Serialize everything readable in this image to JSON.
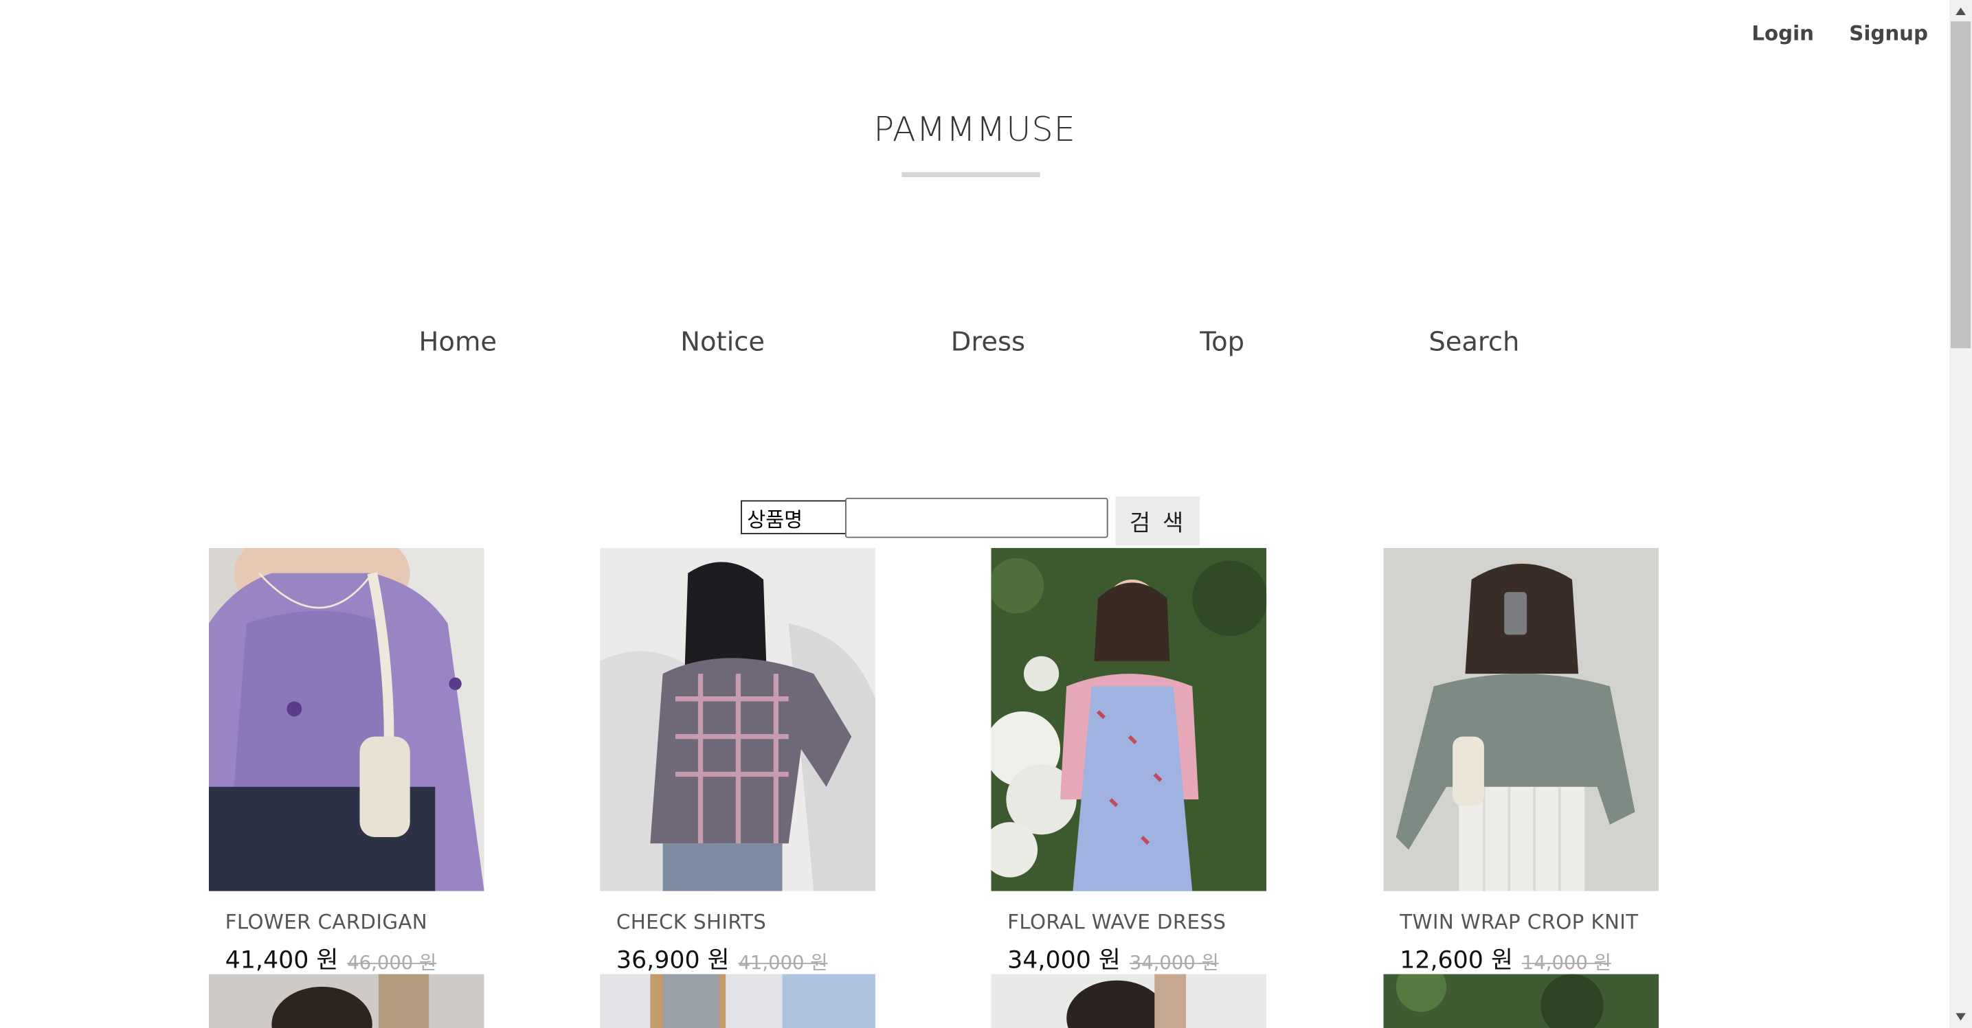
{
  "auth": {
    "login": "Login",
    "signup": "Signup"
  },
  "brand": {
    "title": "PAMMMUSE"
  },
  "nav": [
    "Home",
    "Notice",
    "Dress",
    "Top",
    "Search"
  ],
  "search": {
    "field_option": "상품명",
    "input_value": "",
    "button": "검 색"
  },
  "products": [
    {
      "name": "FLOWER CARDIGAN",
      "price": "41,400 원",
      "original_price": "46,000 원"
    },
    {
      "name": "CHECK SHIRTS",
      "price": "36,900 원",
      "original_price": "41,000 원"
    },
    {
      "name": "FLORAL WAVE DRESS",
      "price": "34,000 원",
      "original_price": "34,000 원"
    },
    {
      "name": "TWIN WRAP CROP KNIT",
      "price": "12,600 원",
      "original_price": "14,000 원"
    }
  ],
  "colors": {
    "accent_line": "#d4d4d4",
    "button_bg": "#ececec",
    "text": "#444444"
  }
}
